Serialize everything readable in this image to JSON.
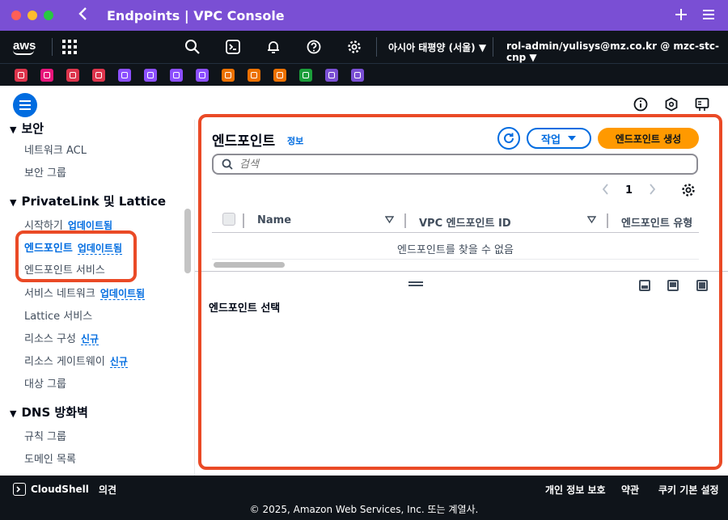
{
  "window": {
    "title": "Endpoints | VPC Console"
  },
  "nav": {
    "logo": "aws",
    "region": "아시아 태평양 (서울) ▼",
    "user": "rol-admin/yulisys@mz.co.kr @ mzc-stc-cnp ▼"
  },
  "favorites": [
    {
      "name": "ec2",
      "color": "#dd344c"
    },
    {
      "name": "cloudwatch",
      "color": "#e7157b"
    },
    {
      "name": "cloudfront",
      "color": "#dd344c"
    },
    {
      "name": "iam",
      "color": "#dd344c"
    },
    {
      "name": "vpc",
      "color": "#8c4fff"
    },
    {
      "name": "route53",
      "color": "#8c4fff"
    },
    {
      "name": "apigateway",
      "color": "#8c4fff"
    },
    {
      "name": "directconnect",
      "color": "#8c4fff"
    },
    {
      "name": "lambda",
      "color": "#ed7100"
    },
    {
      "name": "ecs",
      "color": "#ed7100"
    },
    {
      "name": "eks",
      "color": "#ed7100"
    },
    {
      "name": "s3",
      "color": "#1b9e3a"
    },
    {
      "name": "transit",
      "color": "#7a4fd4"
    },
    {
      "name": "network",
      "color": "#7a4fd4"
    }
  ],
  "sidebar": {
    "section_security": "보안",
    "network_acl": "네트워크 ACL",
    "security_groups": "보안 그룹",
    "section_privatelink": "PrivateLink 및 Lattice",
    "getting_started": "시작하기",
    "endpoints": "엔드포인트",
    "endpoint_services": "엔드포인트 서비스",
    "service_networks": "서비스 네트워크",
    "lattice_services": "Lattice 서비스",
    "resource_configs": "리소스 구성",
    "resource_gateways": "리소스 게이트웨이",
    "target_groups": "대상 그룹",
    "section_dns": "DNS 방화벽",
    "rule_groups": "규칙 그룹",
    "domain_lists": "도메인 목록",
    "badge_updated": "업데이트됨",
    "badge_new": "신규"
  },
  "main": {
    "title": "엔드포인트",
    "info": "정보",
    "actions_label": "작업",
    "create_label": "엔드포인트 생성",
    "search_placeholder": "검색",
    "page": "1",
    "columns": [
      "Name",
      "VPC 엔드포인트 ID",
      "엔드포인트 유형"
    ],
    "empty_message": "엔드포인트를 찾을 수 없음",
    "detail_title": "엔드포인트 선택"
  },
  "footer": {
    "cloudshell": "CloudShell",
    "feedback": "의견",
    "privacy": "개인 정보 보호",
    "terms": "약관",
    "cookies": "쿠키 기본 설정",
    "copyright": "© 2025, Amazon Web Services, Inc. 또는 계열사."
  },
  "colors": {
    "titlebar": "#7a4fd4",
    "nav": "#0f141a",
    "accent": "#006ce0",
    "primary_button": "#ff9900",
    "highlight": "#ea4a26"
  }
}
